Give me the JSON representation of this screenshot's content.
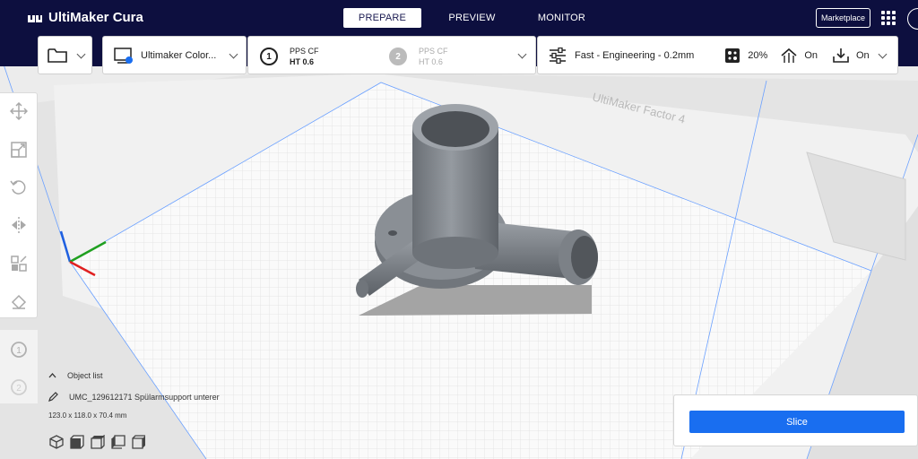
{
  "app": {
    "name": "UltiMaker Cura"
  },
  "tabs": [
    {
      "label": "PREPARE",
      "active": true
    },
    {
      "label": "PREVIEW",
      "active": false
    },
    {
      "label": "MONITOR",
      "active": false
    }
  ],
  "header": {
    "marketplace_label": "Marketplace"
  },
  "printer": {
    "name": "Ultimaker Color..."
  },
  "extruders": [
    {
      "number": "1",
      "material": "PPS CF",
      "core": "HT 0.6",
      "enabled": true
    },
    {
      "number": "2",
      "material": "PPS CF",
      "core": "HT 0.6",
      "enabled": false
    }
  ],
  "print_settings": {
    "profile": "Fast - Engineering - 0.2mm",
    "infill": "20%",
    "support": "On",
    "adhesion": "On"
  },
  "build_plate": {
    "label": "UltiMaker Factor 4"
  },
  "object_list": {
    "title": "Object list",
    "object_name": "UMC_129612171 Spülarmsupport unterer",
    "dimensions": "123.0 x 118.0 x 70.4 mm"
  },
  "slice": {
    "label": "Slice"
  },
  "colors": {
    "header_bg": "#0d0f3f",
    "accent_blue": "#196ef0",
    "model_gray": "#7d8288",
    "axis_x": "#e02020",
    "axis_y": "#20a020",
    "axis_z": "#2060e0"
  }
}
